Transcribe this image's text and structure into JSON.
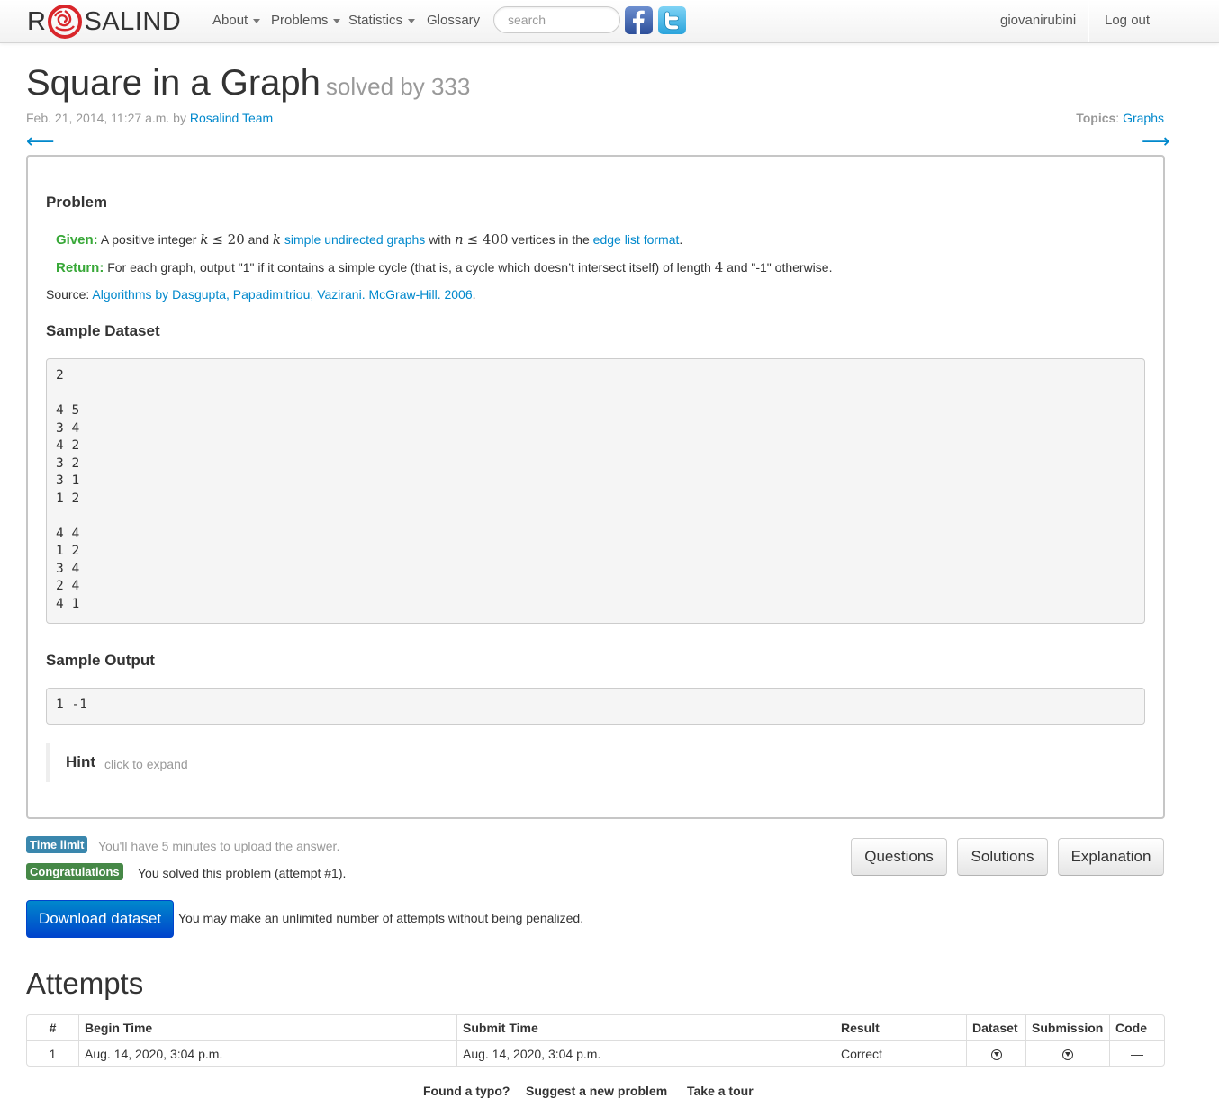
{
  "nav": {
    "brand_left": "R",
    "brand_right": "SALIND",
    "items": [
      {
        "label": "About"
      },
      {
        "label": "Problems"
      },
      {
        "label": "Statistics"
      },
      {
        "label": "Glossary"
      }
    ],
    "search_placeholder": "search",
    "user": "giovanirubini",
    "logout": "Log out"
  },
  "header": {
    "title": "Square in a Graph",
    "solved_by": "solved by 333",
    "date": "Feb. 21, 2014, 11:27 a.m. by",
    "author": "Rosalind Team",
    "topics_label": "Topics",
    "topics_sep": ":",
    "topic": "Graphs",
    "prev_arrow": "⟵",
    "next_arrow": "⟶"
  },
  "problem": {
    "heading": "Problem",
    "given_label": "Given:",
    "given_1": "A positive integer",
    "given_k": "k",
    "given_le20": "≤ 20",
    "given_and": "and",
    "given_k2": "k",
    "given_link1": "simple undirected graphs",
    "given_with": "with",
    "given_n": "n",
    "given_le400": "≤ 400",
    "given_vert": "vertices in the",
    "given_link2": "edge list format",
    "given_end": ".",
    "return_label": "Return:",
    "return_1": "For each graph, output \"1\" if it contains a simple cycle (that is, a cycle which doesn’t intersect itself) of length",
    "return_4": "4",
    "return_2": "and \"-1\" otherwise.",
    "source_label": "Source:",
    "source_link": "Algorithms by Dasgupta, Papadimitriou, Vazirani. McGraw-Hill. 2006",
    "source_end": ".",
    "sample_dataset_heading": "Sample Dataset",
    "sample_dataset": "2\n\n4 5\n3 4\n4 2\n3 2\n3 1\n1 2\n\n4 4\n1 2\n3 4\n2 4\n4 1",
    "sample_output_heading": "Sample Output",
    "sample_output": "1 -1",
    "hint_title": "Hint",
    "hint_sub": "click to expand"
  },
  "status": {
    "time_badge": "Time limit",
    "time_text": "You'll have 5 minutes to upload the answer.",
    "congrats_badge": "Congratulations",
    "congrats_text": "You solved this problem (attempt #1).",
    "download": "Download dataset",
    "download_note": "You may make an unlimited number of attempts without being penalized.",
    "buttons": [
      "Questions",
      "Solutions",
      "Explanation"
    ]
  },
  "attempts": {
    "heading": "Attempts",
    "columns": [
      "#",
      "Begin Time",
      "Submit Time",
      "Result",
      "Dataset",
      "Submission",
      "Code"
    ],
    "rows": [
      {
        "num": "1",
        "begin": "Aug. 14, 2020, 3:04 p.m.",
        "submit": "Aug. 14, 2020, 3:04 p.m.",
        "result": "Correct",
        "code": "—"
      }
    ]
  },
  "footer": {
    "links": [
      "Found a typo?",
      "Suggest a new problem",
      "Take a tour"
    ]
  },
  "colors": {
    "link": "#0088cc",
    "given_green": "#38a838",
    "badge_info": "#3a87ad",
    "badge_success": "#468847",
    "primary_button": "#0055cc"
  }
}
